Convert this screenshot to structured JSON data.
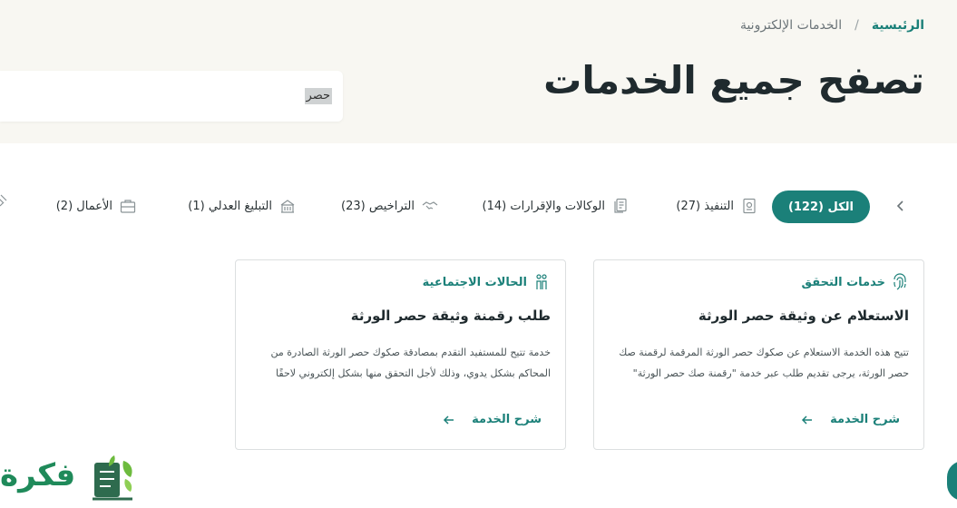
{
  "breadcrumb": {
    "home": "الرئيسية",
    "separator": "/",
    "current": "الخدمات الإلكترونية"
  },
  "page_title": "تصفح جميع الخدمات",
  "search": {
    "value": "حصر",
    "placeholder": ""
  },
  "tabs": [
    {
      "label": "الكل (122)",
      "icon": "",
      "active": true
    },
    {
      "label": "التنفيذ (27)",
      "icon": "document-stamp-icon"
    },
    {
      "label": "الوكالات والإقرارات (14)",
      "icon": "documents-icon"
    },
    {
      "label": "التراخيص (23)",
      "icon": "handshake-icon"
    },
    {
      "label": "التبليغ العدلي (1)",
      "icon": "building-icon"
    },
    {
      "label": "الأعمال (2)",
      "icon": "briefcase-icon"
    }
  ],
  "cards": [
    {
      "category": "خدمات التحقق",
      "category_icon": "fingerprint-icon",
      "title": "الاستعلام عن وثيقة حصر الورثة",
      "description": "تتيح هذه الخدمة الاستعلام عن صكوك حصر الورثة المرقمة لرقمنة صك حصر الورثة، يرجى تقديم طلب عبر خدمة \"رقمنة صك حصر الورثة\"",
      "link": "شرح الخدمة"
    },
    {
      "category": "الحالات الاجتماعية",
      "category_icon": "family-icon",
      "title": "طلب رقمنة وثيقة حصر الورثة",
      "description": "خدمة تتيح للمستفيد التقدم بمصادقة صكوك حصر الورثة الصادرة من المحاكم بشكل يدوي، وذلك لأجل التحقق منها بشكل إلكتروني لاحقًا",
      "link": "شرح الخدمة"
    }
  ],
  "logo_text": "فكرة",
  "colors": {
    "accent": "#1b8079",
    "hero_bg": "#f8f7f2",
    "logo_green": "#1f8a5a"
  }
}
